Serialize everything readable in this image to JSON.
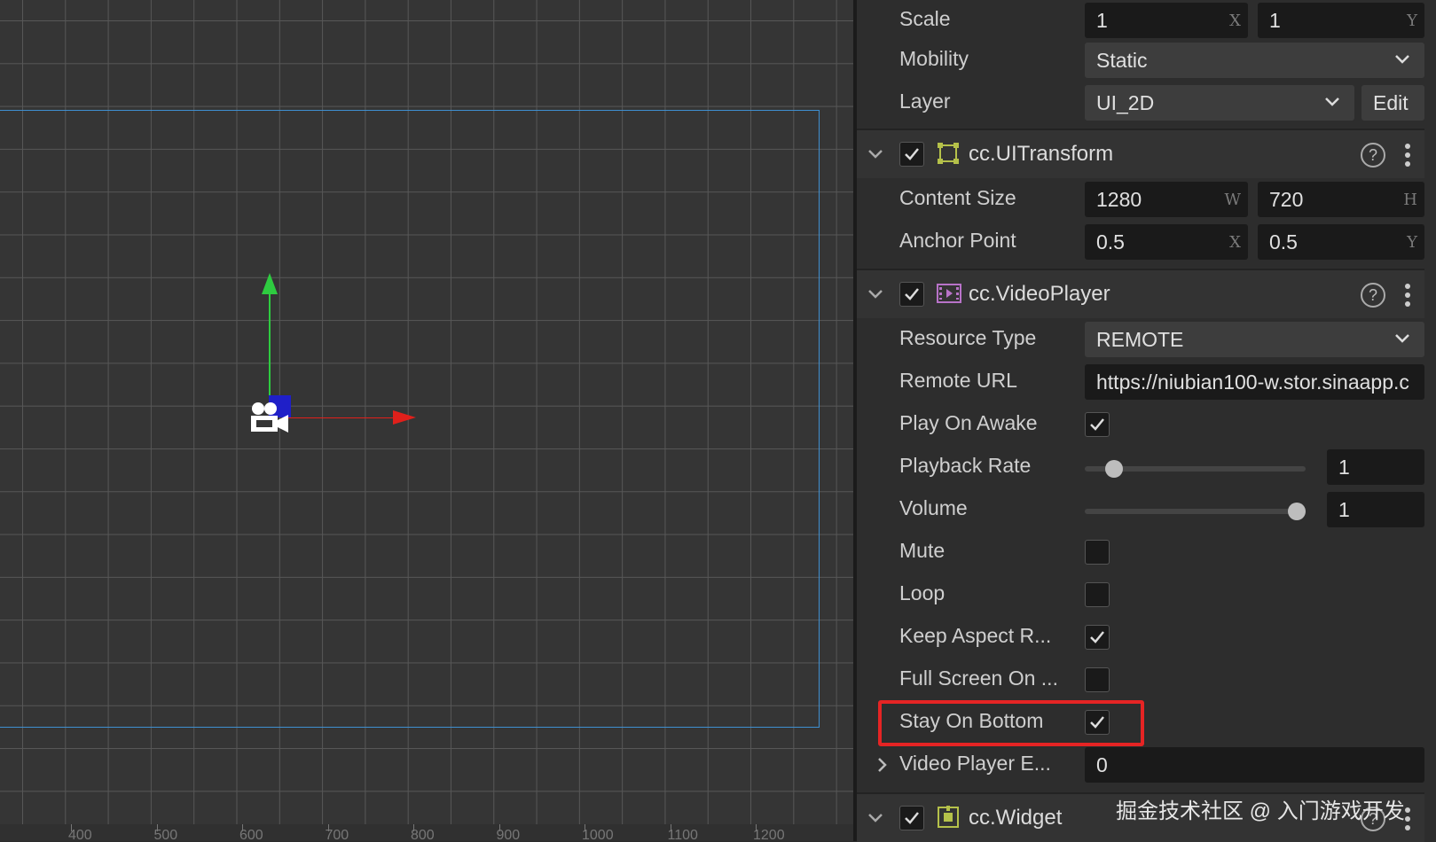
{
  "scene": {
    "ruler_labels": [
      "400",
      "500",
      "600",
      "700",
      "800",
      "900",
      "1000",
      "1100",
      "1200"
    ]
  },
  "inspector": {
    "scale": {
      "label": "Scale",
      "x": "1",
      "x_axis": "X",
      "y": "1",
      "y_axis": "Y"
    },
    "mobility": {
      "label": "Mobility",
      "value": "Static"
    },
    "layer": {
      "label": "Layer",
      "value": "UI_2D",
      "edit": "Edit"
    },
    "ui_transform": {
      "title": "cc.UITransform",
      "enabled": true,
      "help": "?",
      "content_size": {
        "label": "Content Size",
        "w": "1280",
        "w_axis": "W",
        "h": "720",
        "h_axis": "H"
      },
      "anchor_point": {
        "label": "Anchor Point",
        "x": "0.5",
        "x_axis": "X",
        "y": "0.5",
        "y_axis": "Y"
      }
    },
    "video_player": {
      "title": "cc.VideoPlayer",
      "enabled": true,
      "help": "?",
      "resource_type": {
        "label": "Resource Type",
        "value": "REMOTE"
      },
      "remote_url": {
        "label": "Remote URL",
        "value": "https://niubian100-w.stor.sinaapp.c"
      },
      "play_on_awake": {
        "label": "Play On Awake",
        "checked": true
      },
      "playback_rate": {
        "label": "Playback Rate",
        "value": "1",
        "slider_fraction": 0.1
      },
      "volume": {
        "label": "Volume",
        "value": "1",
        "slider_fraction": 1.0
      },
      "mute": {
        "label": "Mute",
        "checked": false
      },
      "loop": {
        "label": "Loop",
        "checked": false
      },
      "keep_aspect": {
        "label": "Keep Aspect R...",
        "checked": true
      },
      "full_screen": {
        "label": "Full Screen On ...",
        "checked": false
      },
      "stay_on_bottom": {
        "label": "Stay On Bottom",
        "checked": true
      },
      "video_player_events": {
        "label": "Video Player E...",
        "value": "0"
      }
    },
    "widget": {
      "title": "cc.Widget",
      "enabled": true,
      "help": "?"
    }
  },
  "watermark": "掘金技术社区 @ 入门游戏开发",
  "colors": {
    "highlight": "#e52424",
    "gizmo_x": "#e0201b",
    "gizmo_y": "#2ecc40",
    "frame": "#3f8fd0"
  }
}
